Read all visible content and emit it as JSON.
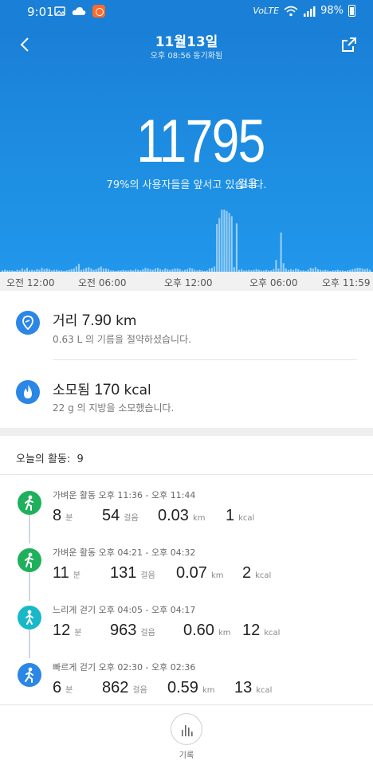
{
  "status_bar": {
    "time": "9:01",
    "left_icons": [
      "image-icon",
      "cloud-icon",
      "app-notification-icon"
    ],
    "right_text": "VoLTE",
    "battery": "98%"
  },
  "header": {
    "title": "11월13일",
    "sync_status": "오후 08:56 동기화됨"
  },
  "summary": {
    "steps": "11795",
    "steps_unit": "걸음",
    "rank_text": "79%의 사용자들을 앞서고 있습니다."
  },
  "time_axis": [
    "오전 12:00",
    "오전 06:00",
    "오후 12:00",
    "오후 06:00",
    "오후 11:59"
  ],
  "stats": [
    {
      "icon": "distance-pin-icon",
      "label": "거리",
      "value": "7.90",
      "unit": "km",
      "sub": "0.63 L 의 기름을 절약하셨습니다."
    },
    {
      "icon": "calorie-flame-icon",
      "label": "소모됨",
      "value": "170",
      "unit": "kcal",
      "sub": "22 g 의 지방을 소모했습니다."
    }
  ],
  "activities_header": {
    "label": "오늘의 활동:",
    "count": "9"
  },
  "activities": [
    {
      "icon": "light-activity-icon",
      "color": "#1fb05b",
      "label": "가벼운 활동 오후 11:36 - 오후 11:44",
      "minutes": "8",
      "minutes_unit": "분",
      "steps": "54",
      "steps_unit": "걸음",
      "distance": "0.03",
      "distance_unit": "km",
      "kcal": "1",
      "kcal_unit": "kcal"
    },
    {
      "icon": "light-activity-icon",
      "color": "#1fb05b",
      "label": "가벼운 활동 오후 04:21 - 오후 04:32",
      "minutes": "11",
      "minutes_unit": "분",
      "steps": "131",
      "steps_unit": "걸음",
      "distance": "0.07",
      "distance_unit": "km",
      "kcal": "2",
      "kcal_unit": "kcal"
    },
    {
      "icon": "slow-walk-icon",
      "color": "#18b8c9",
      "label": "느리게 걷기 오후 04:05 - 오후 04:17",
      "minutes": "12",
      "minutes_unit": "분",
      "steps": "963",
      "steps_unit": "걸음",
      "distance": "0.60",
      "distance_unit": "km",
      "kcal": "12",
      "kcal_unit": "kcal"
    },
    {
      "icon": "brisk-walk-icon",
      "color": "#2b86e6",
      "label": "빠르게 걷기 오후 02:30 - 오후 02:36",
      "minutes": "6",
      "minutes_unit": "분",
      "steps": "862",
      "steps_unit": "걸음",
      "distance": "0.59",
      "distance_unit": "km",
      "kcal": "13",
      "kcal_unit": "kcal"
    }
  ],
  "bottom_nav": {
    "label": "기록",
    "icon": "bar-chart-icon"
  },
  "hourly_activity": [
    0.02,
    0.03,
    0.02,
    0.02,
    0.02,
    0.01,
    0.03,
    0.02,
    0.05,
    0.03,
    0.06,
    0.02,
    0.03,
    0.02,
    0.04,
    0.03,
    0.06,
    0.04,
    0.05,
    0.04,
    0.02,
    0.03,
    0.03,
    0.02,
    0.02,
    0.01,
    0.02,
    0.03,
    0.04,
    0.05,
    0.08,
    0.12,
    0.03,
    0.04,
    0.06,
    0.07,
    0.05,
    0.03,
    0.04,
    0.06,
    0.08,
    0.05,
    0.05,
    0.04,
    0.02,
    0.02,
    0.01,
    0.02,
    0.02,
    0.03,
    0.02,
    0.02,
    0.03,
    0.02,
    0.04,
    0.03,
    0.02,
    0.04,
    0.06,
    0.05,
    0.04,
    0.03,
    0.05,
    0.06,
    0.04,
    0.03,
    0.05,
    0.04,
    0.03,
    0.04,
    0.05,
    0.05,
    0.04,
    0.02,
    0.03,
    0.04,
    0.06,
    0.05,
    0.03,
    0.02,
    0.03,
    0.02,
    0.01,
    0.02,
    0.05,
    0.06,
    0.08,
    0.73,
    0.82,
    0.95,
    0.95,
    0.93,
    0.9,
    0.85,
    0.07,
    0.74,
    0.03,
    0.04,
    0.02,
    0.02,
    0.03,
    0.02,
    0.03,
    0.04,
    0.03,
    0.02,
    0.02,
    0.03,
    0.02,
    0.02,
    0.04,
    0.18,
    0.05,
    0.6,
    0.13,
    0.05,
    0.03,
    0.04,
    0.03,
    0.05,
    0.04,
    0.02,
    0.02,
    0.01,
    0.03,
    0.06,
    0.05,
    0.07,
    0.04,
    0.03,
    0.02,
    0.03,
    0.02,
    0.01,
    0.02,
    0.02,
    0.03,
    0.02,
    0.02,
    0.01,
    0.02,
    0.03,
    0.04,
    0.05,
    0.06,
    0.06,
    0.05,
    0.04,
    0.05,
    0.03
  ]
}
